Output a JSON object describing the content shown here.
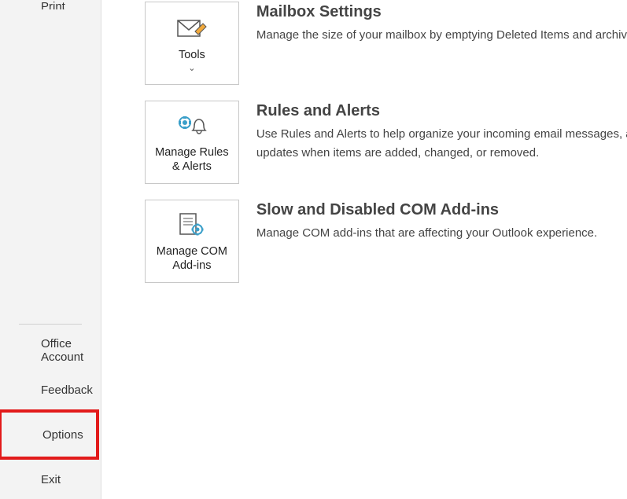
{
  "sidebar": {
    "top": [
      {
        "label": "Print"
      }
    ],
    "bottom": [
      {
        "label": "Office Account"
      },
      {
        "label": "Feedback"
      },
      {
        "label": "Options"
      },
      {
        "label": "Exit"
      }
    ]
  },
  "sections": {
    "mailbox": {
      "tile_label": "Tools",
      "title": "Mailbox Settings",
      "desc": "Manage the size of your mailbox by emptying Deleted Items and archiving."
    },
    "rules": {
      "tile_label": "Manage Rules & Alerts",
      "title": "Rules and Alerts",
      "desc1": "Use Rules and Alerts to help organize your incoming email messages, and receive",
      "desc2": "updates when items are added, changed, or removed."
    },
    "com": {
      "tile_label": "Manage COM Add-ins",
      "title": "Slow and Disabled COM Add-ins",
      "desc": "Manage COM add-ins that are affecting your Outlook experience."
    }
  }
}
